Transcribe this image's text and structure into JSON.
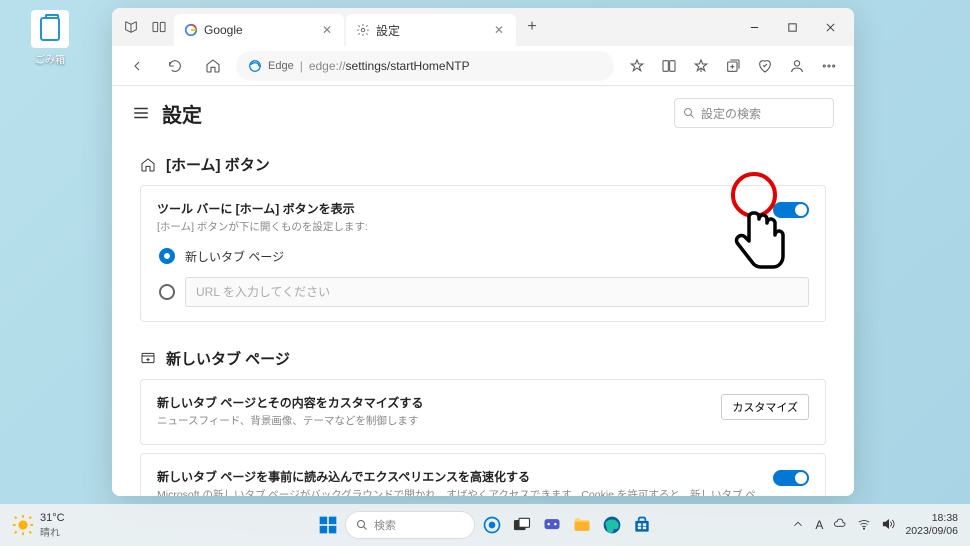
{
  "desktop": {
    "recycle_bin": "ごみ箱"
  },
  "browser": {
    "tabs": [
      {
        "title": "Google"
      },
      {
        "title": "設定"
      }
    ],
    "url": {
      "prefix": "Edge",
      "sep": "|",
      "scheme": "edge://",
      "path": "settings/startHomeNTP"
    }
  },
  "settings": {
    "title": "設定",
    "search_placeholder": "設定の検索",
    "sections": {
      "home": {
        "title": "[ホーム] ボタン",
        "card1": {
          "title": "ツール バーに [ホーム] ボタンを表示",
          "desc": "[ホーム] ボタンが下に開くものを設定します:"
        },
        "radio_newtab": "新しいタブ ページ",
        "url_placeholder": "URL を入力してください"
      },
      "newtab": {
        "title": "新しいタブ ページ",
        "card1": {
          "title": "新しいタブ ページとその内容をカスタマイズする",
          "desc": "ニュースフィード、背景画像、テーマなどを制御します",
          "button": "カスタマイズ"
        },
        "card2": {
          "title": "新しいタブ ページを事前に読み込んでエクスペリエンスを高速化する",
          "desc": "Microsoft の新しいタブ ページがバックグラウンドで開かれ、すばやくアクセスできます。Cookie を許可すると、新しいタブ ページのコンテンツに Cookie が含まれる場合があります"
        }
      }
    }
  },
  "taskbar": {
    "temp": "31°C",
    "condition": "晴れ",
    "search_placeholder": "検索",
    "tray": {
      "lang": "A",
      "time": "18:38",
      "date": "2023/09/06"
    }
  }
}
